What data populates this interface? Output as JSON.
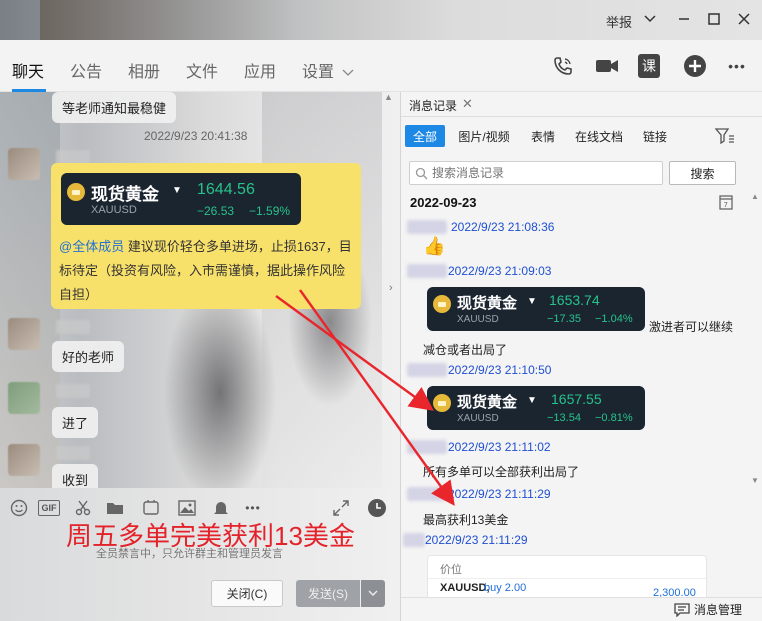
{
  "window": {
    "report_label": "举报",
    "minimize": "—",
    "maximize": "☐",
    "close": "✕",
    "chevron": "⌄"
  },
  "tabs": [
    {
      "label": "聊天",
      "active": true
    },
    {
      "label": "公告"
    },
    {
      "label": "相册"
    },
    {
      "label": "文件"
    },
    {
      "label": "应用"
    },
    {
      "label": "设置"
    }
  ],
  "toolbar_icons": [
    "phone-icon",
    "video-icon",
    "course-icon",
    "add-icon",
    "more-icon"
  ],
  "toolbar": {
    "course_label": "课",
    "more_label": "•••"
  },
  "chat": {
    "first_message": "等老师通知最稳健",
    "timestamp": "2022/9/23 20:41:38",
    "gold_card": {
      "name": "现货黄金",
      "symbol": "XAUUSD",
      "price": "1644.56",
      "change": "−26.53",
      "change_pct": "−1.59%"
    },
    "announcement_at": "@全体成员",
    "announcement_text": " 建议现价轻仓多单进场，止损1637，目标待定（投资有风险，入市需谨慎，据此操作风险自担）",
    "replies": [
      "好的老师",
      "进了",
      "收到"
    ]
  },
  "input": {
    "promo_text": "周五多单完美获利13美金",
    "mute_tip": "全员禁言中，只允许群主和管理员发言",
    "close_button": "关闭(C)",
    "send_button": "发送(S)",
    "gif_label": "GIF"
  },
  "history": {
    "tab_title": "消息记录",
    "filters": [
      "全部",
      "图片/视频",
      "表情",
      "在线文档",
      "链接"
    ],
    "search_placeholder": "搜索消息记录",
    "search_button": "搜索",
    "date": "2022-09-23",
    "entries": [
      {
        "time": "2022/9/23 21:08:36"
      },
      {
        "time": "2022/9/23 21:09:03",
        "card": {
          "name": "现货黄金",
          "symbol": "XAUUSD",
          "price": "1653.74",
          "change": "−17.35",
          "change_pct": "−1.04%"
        },
        "text_after": "激进者可以继续",
        "text_line2": "减仓或者出局了"
      },
      {
        "time": "2022/9/23 21:10:50",
        "card": {
          "name": "现货黄金",
          "symbol": "XAUUSD",
          "price": "1657.55",
          "change": "−13.54",
          "change_pct": "−0.81%"
        }
      },
      {
        "time": "2022/9/23 21:11:02",
        "text": "所有多单可以全部获利出局了"
      },
      {
        "time": "2022/9/23 21:11:29",
        "text": "最高获利13美金"
      },
      {
        "time": "2022/9/23 21:11:29"
      }
    ],
    "mini_card": {
      "header": "价位",
      "symbol": "XAUUSD,",
      "action": "buy 2.00",
      "value": "2,300.00"
    },
    "manage_label": "消息管理"
  }
}
